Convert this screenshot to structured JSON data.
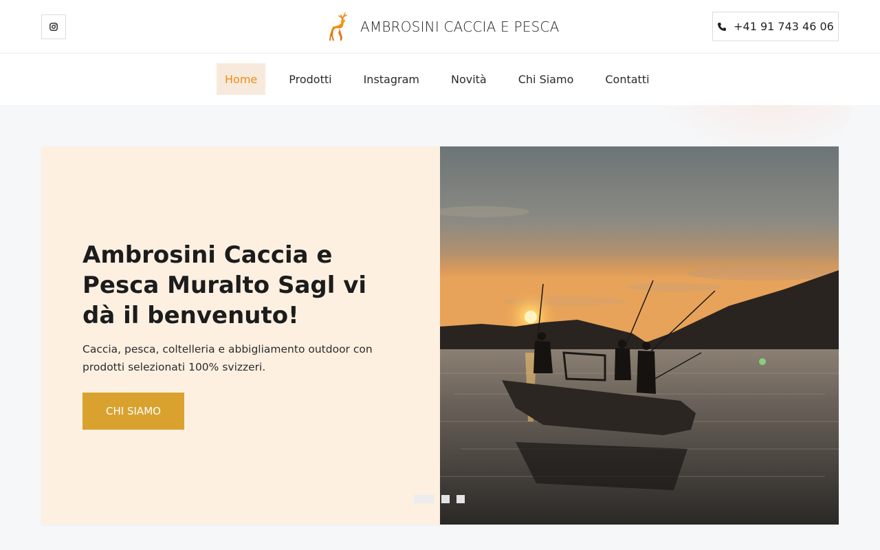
{
  "header": {
    "brand_name": "AMBROSINI CACCIA E PESCA",
    "phone": "+41 91 743 46 06",
    "instagram_icon": "instagram-icon",
    "phone_icon": "phone-icon",
    "logo": "deer-logo"
  },
  "nav": {
    "items": [
      {
        "label": "Home",
        "active": true
      },
      {
        "label": "Prodotti"
      },
      {
        "label": "Instagram"
      },
      {
        "label": "Novità"
      },
      {
        "label": "Chi Siamo"
      },
      {
        "label": "Contatti"
      }
    ]
  },
  "hero": {
    "title": "Ambrosini Caccia e Pesca Muralto Sagl vi dà il benvenuto!",
    "subtitle": "Caccia, pesca, coltelleria e abbigliamento outdoor con prodotti selezionati 100% svizzeri.",
    "cta_label": "CHI SIAMO",
    "image": "sunset fishing boat",
    "slides": 3,
    "active_slide": 1
  },
  "colors": {
    "accent": "#f08a12",
    "button": "#d9a22f",
    "hero_bg": "#fdf0e1",
    "nav_active_bg": "#f7eadd"
  }
}
